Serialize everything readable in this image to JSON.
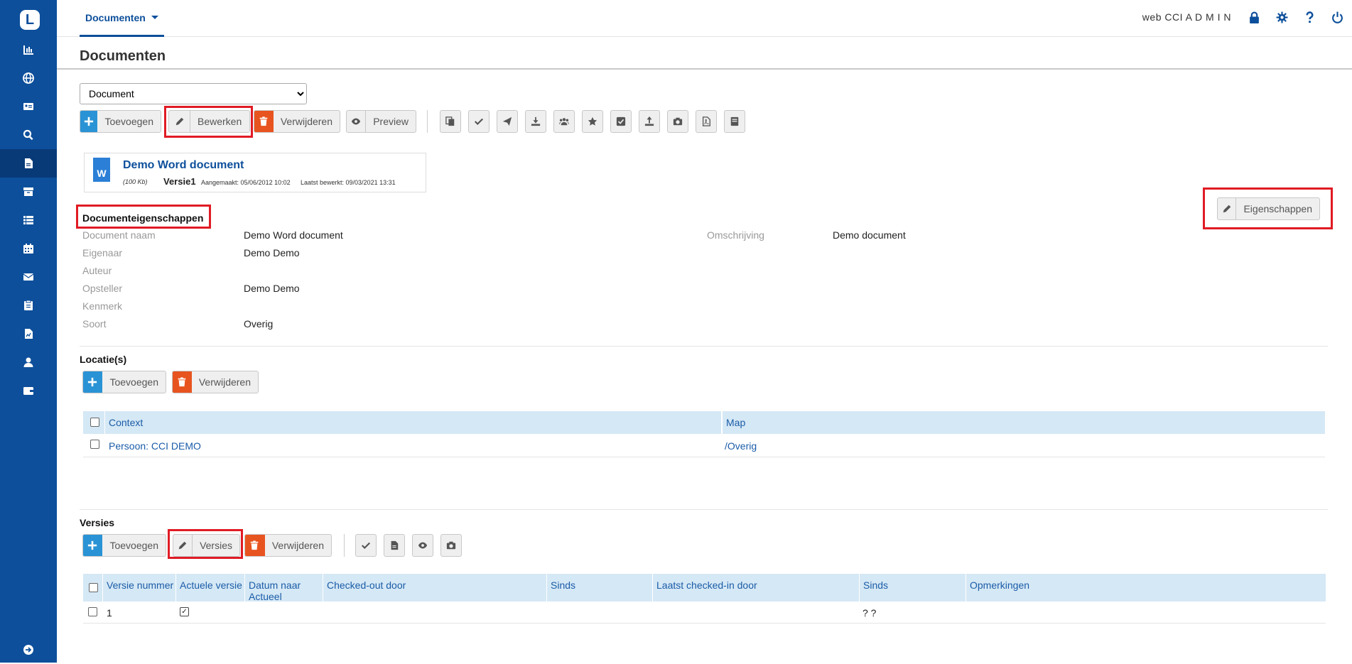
{
  "top": {
    "tab_label": "Documenten",
    "user": "web CCI A D M I N"
  },
  "page": {
    "title": "Documenten"
  },
  "selector": {
    "value": "Document",
    "options": [
      "Document"
    ]
  },
  "toolbar": {
    "add": "Toevoegen",
    "edit": "Bewerken",
    "delete": "Verwijderen",
    "preview": "Preview"
  },
  "document": {
    "name": "Demo Word document",
    "icon_letter": "W",
    "size": "(100 Kb)",
    "version": "Versie1",
    "created": "Aangemaakt: 05/06/2012 10:02",
    "edited": "Laatst bewerkt: 09/03/2021 13:31"
  },
  "properties": {
    "title": "Documenteigenschappen",
    "button": "Eigenschappen",
    "rows": [
      {
        "label": "Document naam",
        "value": "Demo Word document"
      },
      {
        "label": "Eigenaar",
        "value": "Demo Demo"
      },
      {
        "label": "Auteur",
        "value": ""
      },
      {
        "label": "Opsteller",
        "value": "Demo Demo"
      },
      {
        "label": "Kenmerk",
        "value": ""
      },
      {
        "label": "Soort",
        "value": "Overig"
      }
    ],
    "description_label": "Omschrijving",
    "description_value": "Demo document"
  },
  "locations": {
    "title": "Locatie(s)",
    "add": "Toevoegen",
    "delete": "Verwijderen",
    "columns": [
      "Context",
      "Map"
    ],
    "rows": [
      {
        "context": "Persoon: CCI DEMO",
        "map": "/Overig"
      }
    ]
  },
  "versions": {
    "title": "Versies",
    "add": "Toevoegen",
    "versions_btn": "Versies",
    "delete": "Verwijderen",
    "columns": [
      "Versie nummer",
      "Actuele versie",
      "Datum naar Actueel",
      "Checked-out door",
      "Sinds",
      "Laatst checked-in door",
      "Sinds",
      "Opmerkingen"
    ],
    "rows": [
      {
        "nummer": "1",
        "actueel": true,
        "datum": "",
        "checked_out": "",
        "sinds": "",
        "checked_in": "",
        "sinds2": "? ?",
        "opmerkingen": ""
      }
    ]
  },
  "colors": {
    "primary": "#0d4f9b",
    "add": "#2a93d5",
    "delete": "#e8541f",
    "highlight": "#e01b24",
    "table_header": "#d5e8f5"
  }
}
